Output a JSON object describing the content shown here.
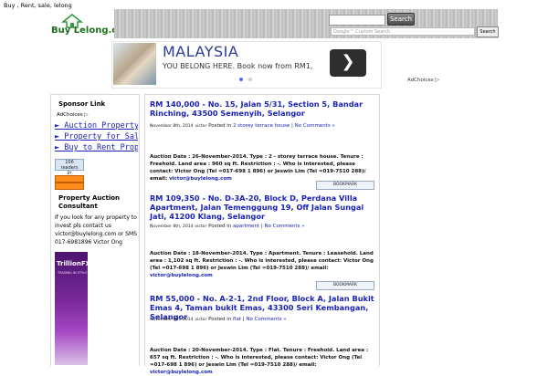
{
  "header": {
    "tagline": "Buy , Rent, sale, lelong",
    "logo_text_buy": "Buy",
    "logo_text_lelong": "Lelong",
    "logo_text_com": ".com",
    "search_button": "Search",
    "custom_search_placeholder": "Google™ Custom Search",
    "custom_search_button": "Search"
  },
  "ad": {
    "title": "MALAYSIA",
    "subtitle": "YOU BELONG HERE. Book now from RM1,",
    "next_arrow": "❯",
    "adchoices": "AdChoices"
  },
  "sidebar": {
    "sponsor_title": "Sponsor Link",
    "adchoices": "AdChoices",
    "links": [
      "► Auction Property",
      "► Property for Sal",
      "► Buy to Rent Prop"
    ],
    "readers_count": "106 readers",
    "readers_by": "BY FEEDBURNER",
    "consult_title": "Property Auction Consultant",
    "consult_text": "If you look for any property to invest pls contact us victor@buylelong.com or SMS 017-6981896 Victor Ong",
    "trillion_logo": "TrillionFX",
    "trillion_sub": "TRADING IN STYLE"
  },
  "posts": [
    {
      "title": "RM 140,000 - No. 15, Jalan 5/31, Section 5, Bandar Rinching, 43500 Semenyih, Selangor",
      "date": "November 8th, 2014",
      "author": "victor",
      "posted_in": "Posted in",
      "category": "2 storey terrace house",
      "comments": "No Comments »",
      "body": "Auction Date : 26-November-2014. Type : 2 - storey terrace house. Tenure : Freehold. Land area : 960 sq ft. Restriction : -. Who is interested, please contact: Victor Ong (Tel =017-698 1 896) or Jeswin Lim (Tel =019-7510 288)/ email:",
      "email": "victor@buylelong.com"
    },
    {
      "title": "RM 109,350 - No. D-3A-20, Block D, Perdana Villa Apartment, Jalan Temenggung 19, Off Jalan Sungai Jati, 41200 Klang, Selangor",
      "date": "November 8th, 2014",
      "author": "victor",
      "posted_in": "Posted in",
      "category": "apartment",
      "comments": "No Comments »",
      "body": "Auction Date : 18-November-2014. Type : Apartment. Tenure : Leasehold. Land area : 1,102 sq ft. Restriction : -. Who is interested, please contact: Victor Ong (Tel =017-698 1 896) or Jeswin Lim (Tel =019-7510 288)/ email:",
      "email": "victor@buylelong.com"
    },
    {
      "title": "RM 55,000 - No. A-2-1, 2nd Floor, Block A, Jalan Bukit Emas 4, Taman bukit Emas, 43300 Seri Kembangan, Selangor",
      "date": "November 8th, 2014",
      "author": "victor",
      "posted_in": "Posted in",
      "category": "flat",
      "comments": "No Comments »",
      "body": "Auction Date : 20-November-2014. Type : Flat. Tenure : Freehold. Land area : 657 sq ft. Restriction : -. Who is interested, please contact: Victor Ong (Tel =017-698 1 896) or Jeswin Lim (Tel =019-7510 288)/ email:",
      "email": "victor@buylelong.com"
    }
  ],
  "bookmark_label": "BOOKMARK",
  "colors": {
    "link": "#1a22b8",
    "logo_green": "#1b6e1b",
    "ad_title": "#2a3d9a",
    "feed_orange": "#ff8c1a"
  }
}
